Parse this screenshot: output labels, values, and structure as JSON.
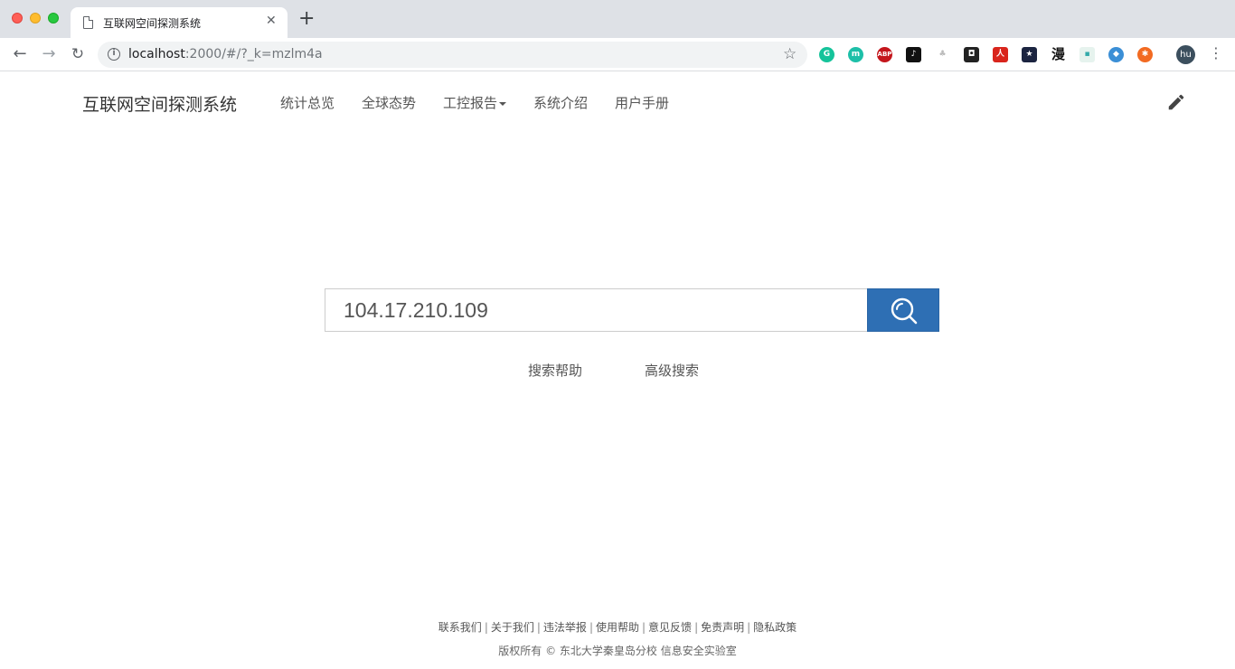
{
  "browser": {
    "tab_title": "互联网空间探测系统",
    "url_host": "localhost",
    "url_rest": ":2000/#/?_k=mzlm4a",
    "profile_initials": "hu",
    "extension_abp_label": "ABP",
    "extension_man_label": "漫"
  },
  "site": {
    "brand": "互联网空间探测系统",
    "nav": {
      "stats": "统计总览",
      "global": "全球态势",
      "ics_report": "工控报告",
      "intro": "系统介绍",
      "manual": "用户手册"
    }
  },
  "search": {
    "value": "104.17.210.109",
    "help_label": "搜索帮助",
    "advanced_label": "高级搜索",
    "button_color": "#2e6fb4"
  },
  "footer": {
    "links": [
      "联系我们",
      "关于我们",
      "违法举报",
      "使用帮助",
      "意见反馈",
      "免责声明",
      "隐私政策"
    ],
    "copyright": "版权所有 © 东北大学秦皇岛分校 信息安全实验室"
  }
}
